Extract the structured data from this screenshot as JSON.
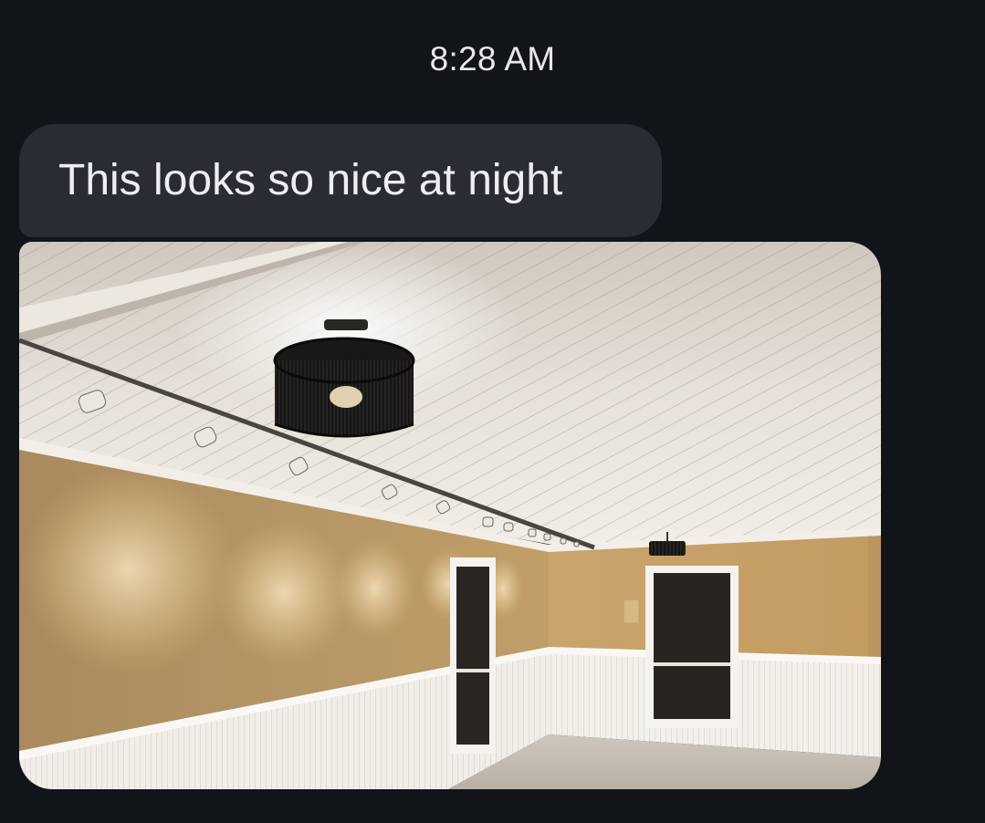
{
  "conversation": {
    "timestamp": "8:28 AM",
    "messages": [
      {
        "type": "text",
        "direction": "incoming",
        "text": "This looks so nice at night"
      },
      {
        "type": "image",
        "direction": "incoming",
        "subject": "interior-room-photo"
      }
    ]
  },
  "colors": {
    "background": "#111419",
    "bubble": "#292d33",
    "text": "#eceef1"
  }
}
